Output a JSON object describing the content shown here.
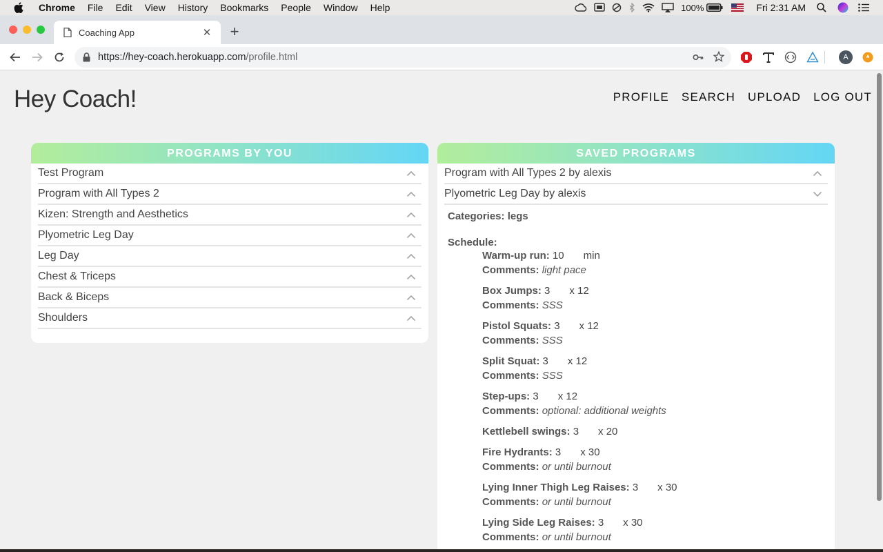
{
  "menubar": {
    "app": "Chrome",
    "items": [
      "File",
      "Edit",
      "View",
      "History",
      "Bookmarks",
      "People",
      "Window",
      "Help"
    ],
    "battery": "100%",
    "clock": "Fri 2:31 AM"
  },
  "browser": {
    "tab_title": "Coaching App",
    "url_host": "https://hey-coach.herokuapp.com",
    "url_path": "/profile.html",
    "profile_initial": "A"
  },
  "header": {
    "brand": "Hey Coach!",
    "nav": [
      "PROFILE",
      "SEARCH",
      "UPLOAD",
      "LOG OUT"
    ]
  },
  "programs_by_you": {
    "title": "PROGRAMS BY YOU",
    "items": [
      "Test Program",
      "Program with All Types 2",
      "Kizen: Strength and Aesthetics",
      "Plyometric Leg Day",
      "Leg Day",
      "Chest & Triceps",
      "Back & Biceps",
      "Shoulders"
    ]
  },
  "saved_programs": {
    "title": "SAVED PROGRAMS",
    "items": [
      "Program with All Types 2 by alexis",
      "Plyometric Leg Day by alexis"
    ],
    "categories_label": "Categories:",
    "categories_value": "legs",
    "schedule_label": "Schedule:",
    "comments_label": "Comments:",
    "exercises": [
      {
        "name": "Warm-up run:",
        "a": "10",
        "b": "min",
        "comment": "light pace"
      },
      {
        "name": "Box Jumps:",
        "a": "3",
        "b": "x 12",
        "comment": "SSS"
      },
      {
        "name": "Pistol Squats:",
        "a": "3",
        "b": "x 12",
        "comment": "SSS"
      },
      {
        "name": "Split Squat:",
        "a": "3",
        "b": "x 12",
        "comment": "SSS"
      },
      {
        "name": "Step-ups:",
        "a": "3",
        "b": "x 12",
        "comment": "optional: additional weights"
      },
      {
        "name": "Kettlebell swings:",
        "a": "3",
        "b": "x 20",
        "comment": ""
      },
      {
        "name": "Fire Hydrants:",
        "a": "3",
        "b": "x 30",
        "comment": "or until burnout"
      },
      {
        "name": "Lying Inner Thigh Leg Raises:",
        "a": "3",
        "b": "x 30",
        "comment": "or until burnout"
      },
      {
        "name": "Lying Side Leg Raises:",
        "a": "3",
        "b": "x 30",
        "comment": "or until burnout"
      }
    ]
  },
  "colors": {
    "gradient_start": "#b3ed9c",
    "gradient_end": "#64d6f5",
    "page_bg": "#f0f0f0"
  }
}
